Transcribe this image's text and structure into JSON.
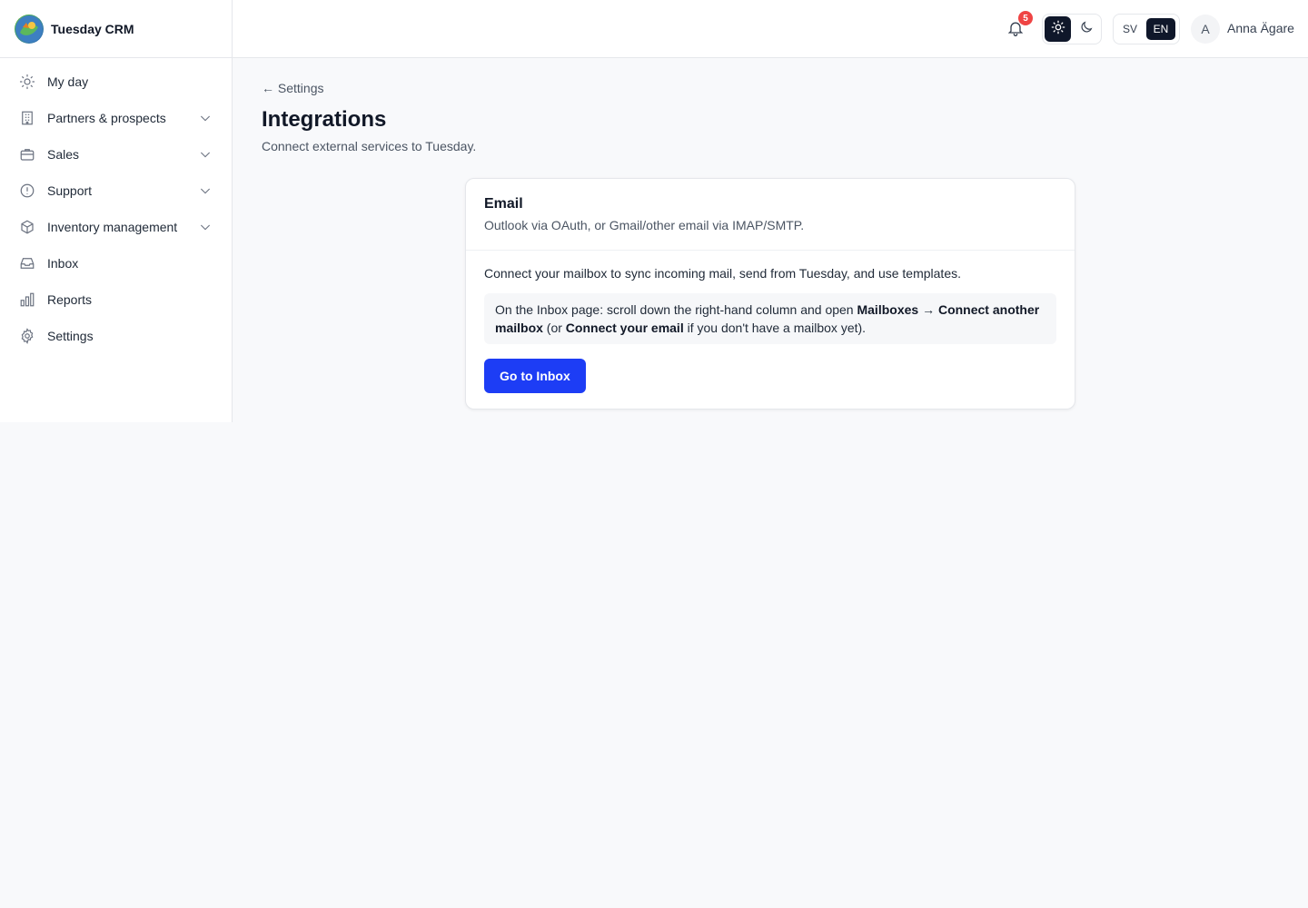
{
  "brand": {
    "name": "Tuesday CRM"
  },
  "sidebar": {
    "items": [
      {
        "label": "My day",
        "icon": "sun-icon",
        "expandable": false
      },
      {
        "label": "Partners & prospects",
        "icon": "building-icon",
        "expandable": true
      },
      {
        "label": "Sales",
        "icon": "briefcase-icon",
        "expandable": true
      },
      {
        "label": "Support",
        "icon": "alert-circle-icon",
        "expandable": true
      },
      {
        "label": "Inventory management",
        "icon": "box-icon",
        "expandable": true
      },
      {
        "label": "Inbox",
        "icon": "inbox-icon",
        "expandable": false
      },
      {
        "label": "Reports",
        "icon": "bar-chart-icon",
        "expandable": false
      },
      {
        "label": "Settings",
        "icon": "gear-icon",
        "expandable": false
      }
    ]
  },
  "topbar": {
    "notifications_count": "5",
    "theme": {
      "active": "light"
    },
    "lang": {
      "sv": "SV",
      "en": "EN",
      "active": "EN"
    },
    "user": {
      "initial": "A",
      "name": "Anna Ägare"
    }
  },
  "page": {
    "back_label": "← Settings",
    "title": "Integrations",
    "subtitle": "Connect external services to Tuesday."
  },
  "email_card": {
    "title": "Email",
    "subtitle": "Outlook via OAuth, or Gmail/other email via IMAP/SMTP.",
    "text": "Connect your mailbox to sync incoming mail, send from Tuesday, and use templates.",
    "hint": {
      "part1": "On the Inbox page: scroll down the right-hand column and open ",
      "bold1": "Mailboxes",
      "arrow": " → ",
      "bold2": "Connect another mailbox",
      "part2": " (or ",
      "bold3": "Connect your email",
      "part3": " if you don't have a mailbox yet)."
    },
    "button_label": "Go to Inbox"
  },
  "colors": {
    "accent": "#1d3df5",
    "badge": "#ef4444",
    "dark_toggle": "#0f172a",
    "background": "#f8f9fb"
  }
}
